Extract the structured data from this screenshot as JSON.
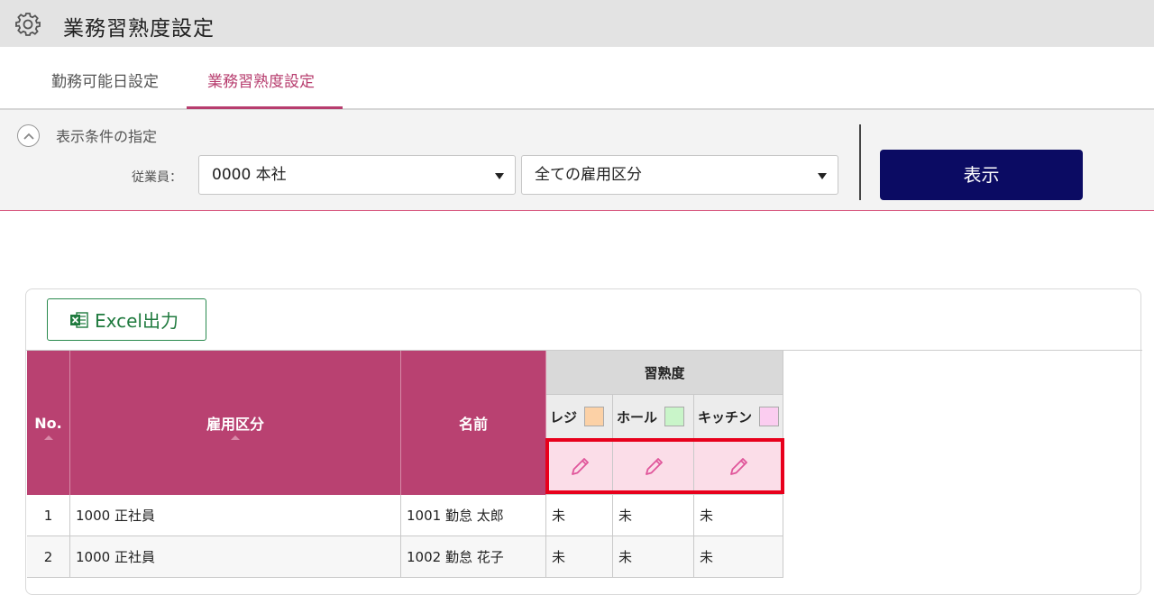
{
  "header": {
    "title": "業務習熟度設定",
    "icon": "gear-icon"
  },
  "tabs": [
    {
      "label": "勤務可能日設定",
      "active": false
    },
    {
      "label": "業務習熟度設定",
      "active": true
    }
  ],
  "filter": {
    "heading": "表示条件の指定",
    "employee_label": "従業員：",
    "employee_value": "0000 本社",
    "employment_value": "全ての雇用区分",
    "show_button": "表示"
  },
  "toolbar": {
    "excel_label": "Excel出力"
  },
  "table": {
    "headers": {
      "no": "No.",
      "employment": "雇用区分",
      "name": "名前",
      "proficiency": "習熟度"
    },
    "skills": [
      {
        "label": "レジ",
        "color": "#fcd1a6"
      },
      {
        "label": "ホール",
        "color": "#c9f5c9"
      },
      {
        "label": "キッチン",
        "color": "#fbcdf0"
      }
    ],
    "rows": [
      {
        "no": "1",
        "employment": "1000 正社員",
        "name": "1001 勤怠 太郎",
        "levels": [
          "未",
          "未",
          "未"
        ]
      },
      {
        "no": "2",
        "employment": "1000 正社員",
        "name": "1002 勤怠 花子",
        "levels": [
          "未",
          "未",
          "未"
        ]
      }
    ]
  },
  "colors": {
    "accent": "#b94171",
    "primary_button": "#0b0b63",
    "highlight": "#e8001c"
  }
}
